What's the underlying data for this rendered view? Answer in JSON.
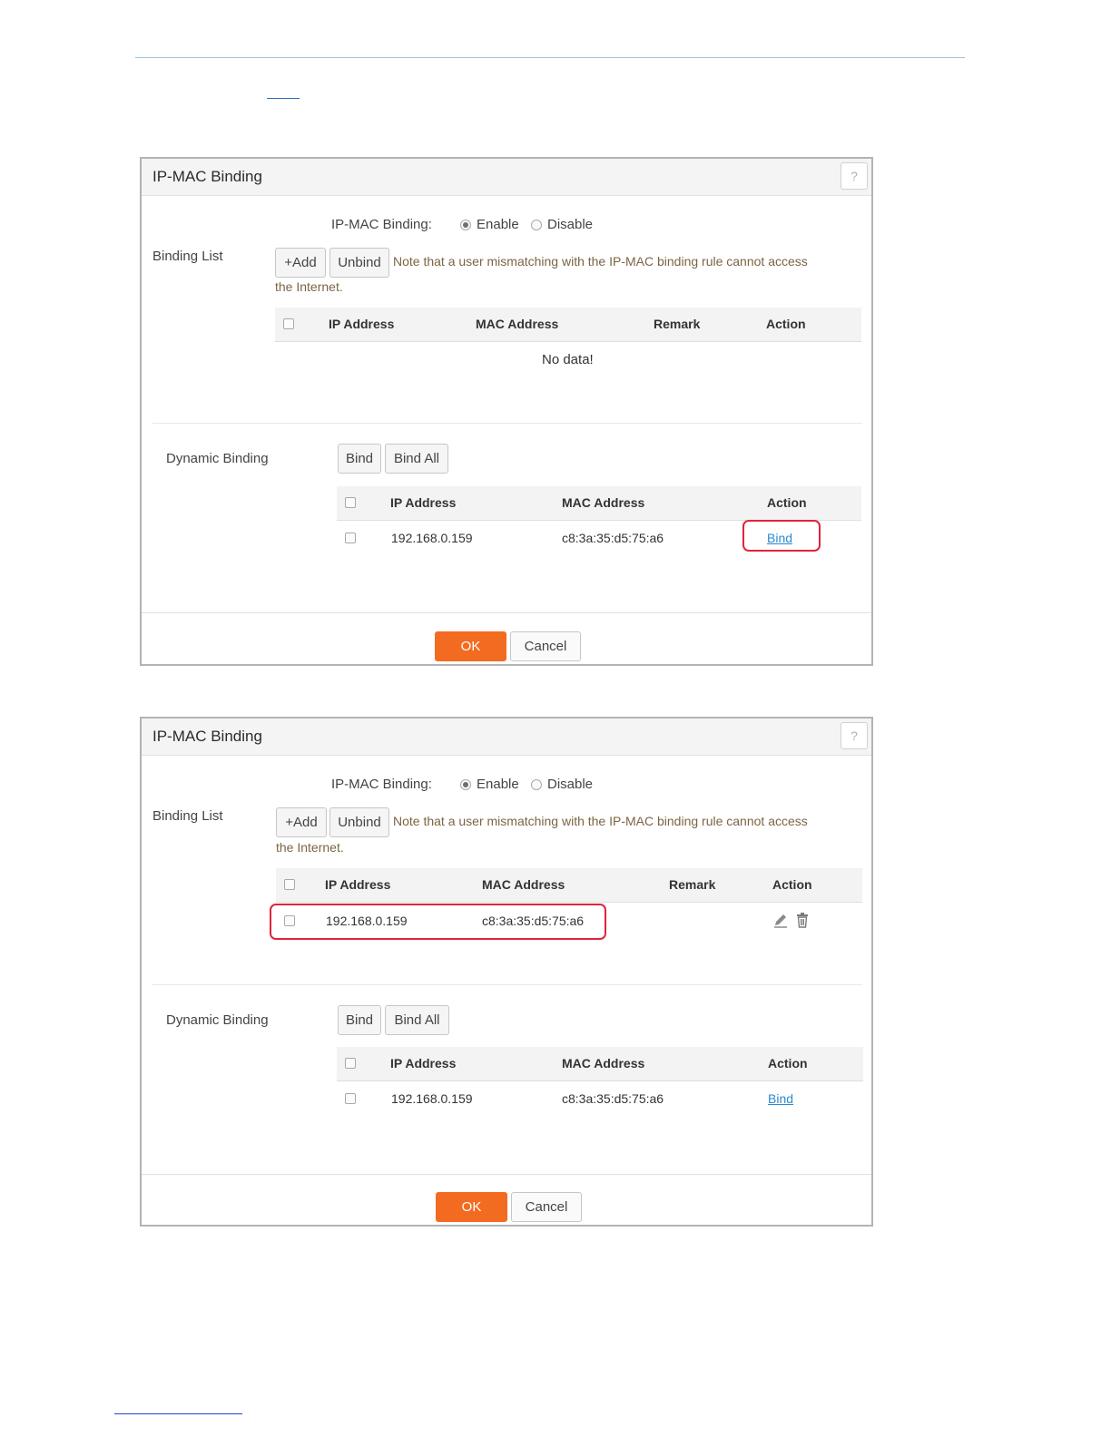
{
  "dialogs": [
    {
      "title": "IP-MAC Binding",
      "help_label": "?",
      "binding_label": "IP-MAC Binding:",
      "radio_enable": "Enable",
      "radio_disable": "Disable",
      "binding_list_label": "Binding List",
      "add_button": "+Add",
      "unbind_button": "Unbind",
      "note_line1": "Note that a user mismatching with the IP-MAC binding rule cannot access",
      "note_line2": "the Internet.",
      "list_headers": {
        "ip": "IP Address",
        "mac": "MAC Address",
        "remark": "Remark",
        "action": "Action"
      },
      "list_empty": "No data!",
      "dynamic_label": "Dynamic Binding",
      "bind_button": "Bind",
      "bind_all_button": "Bind All",
      "dyn_headers": {
        "ip": "IP Address",
        "mac": "MAC Address",
        "action": "Action"
      },
      "dyn_row": {
        "ip": "192.168.0.159",
        "mac": "c8:3a:35:d5:75:a6",
        "action": "Bind"
      },
      "ok_button": "OK",
      "cancel_button": "Cancel"
    },
    {
      "title": "IP-MAC Binding",
      "help_label": "?",
      "binding_label": "IP-MAC Binding:",
      "radio_enable": "Enable",
      "radio_disable": "Disable",
      "binding_list_label": "Binding List",
      "add_button": "+Add",
      "unbind_button": "Unbind",
      "note_line1": "Note that a user mismatching with the IP-MAC binding rule cannot access",
      "note_line2": "the Internet.",
      "list_headers": {
        "ip": "IP Address",
        "mac": "MAC Address",
        "remark": "Remark",
        "action": "Action"
      },
      "list_row": {
        "ip": "192.168.0.159",
        "mac": "c8:3a:35:d5:75:a6"
      },
      "dynamic_label": "Dynamic Binding",
      "bind_button": "Bind",
      "bind_all_button": "Bind All",
      "dyn_headers": {
        "ip": "IP Address",
        "mac": "MAC Address",
        "action": "Action"
      },
      "dyn_row": {
        "ip": "192.168.0.159",
        "mac": "c8:3a:35:d5:75:a6",
        "action": "Bind"
      },
      "ok_button": "OK",
      "cancel_button": "Cancel"
    }
  ],
  "colors": {
    "ok_button": "#f36b21",
    "highlight": "#e0243a",
    "link": "#2a8ad0",
    "note_text": "#7d6443"
  },
  "icons": [
    "edit-icon",
    "trash-icon"
  ]
}
